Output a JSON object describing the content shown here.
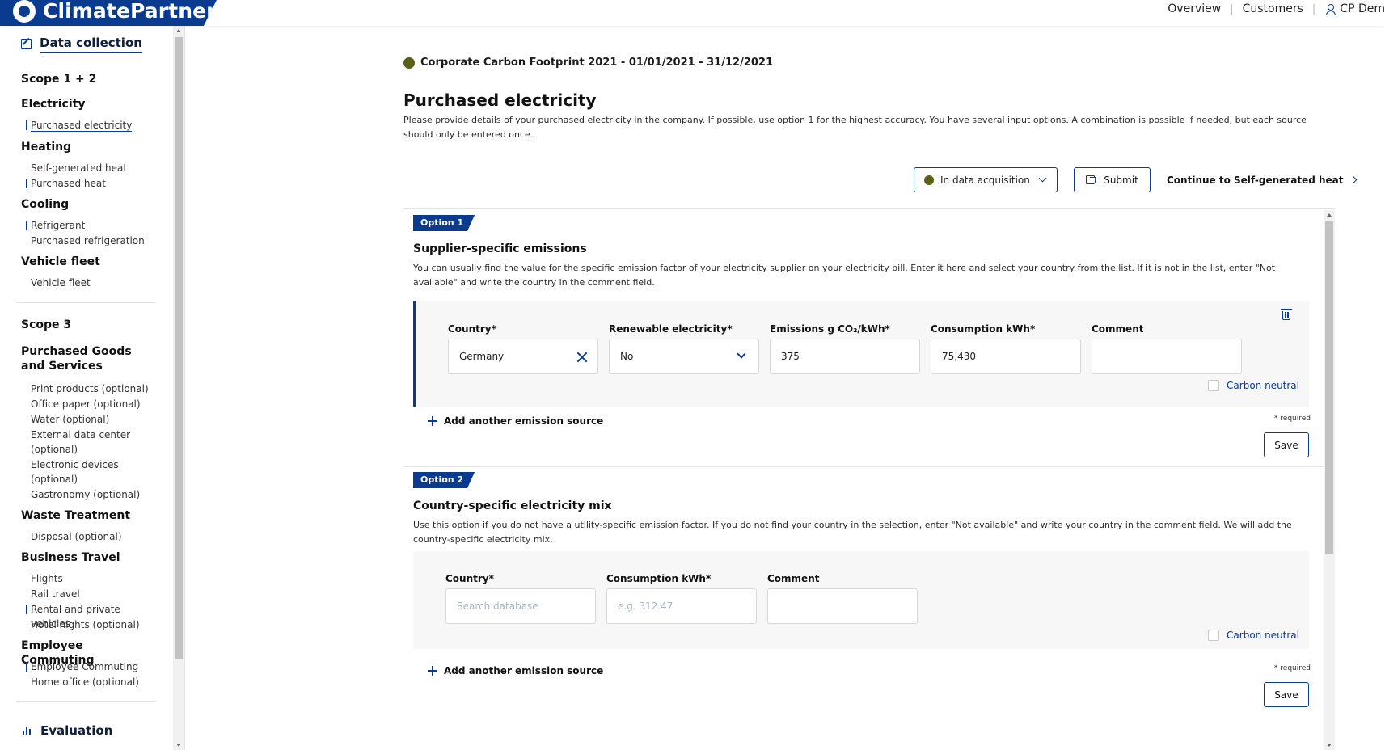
{
  "app": {
    "brand": "ClimatePartner"
  },
  "topnav": {
    "overview": "Overview",
    "customers": "Customers",
    "user": "CP Dem",
    "sep": "|"
  },
  "sidebar": {
    "data_collection": "Data collection",
    "scope12": "Scope 1 + 2",
    "electricity": {
      "title": "Electricity",
      "items": [
        "Purchased electricity"
      ]
    },
    "heating": {
      "title": "Heating",
      "items": [
        "Self-generated heat",
        "Purchased heat"
      ]
    },
    "cooling": {
      "title": "Cooling",
      "items": [
        "Refrigerant",
        "Purchased refrigeration"
      ]
    },
    "vehicle": {
      "title": "Vehicle fleet",
      "items": [
        "Vehicle fleet"
      ]
    },
    "scope3": "Scope 3",
    "goods": {
      "title": "Purchased Goods and Services",
      "items": [
        "Print products (optional)",
        "Office paper (optional)",
        "Water (optional)",
        "External data center (optional)",
        "Electronic devices (optional)",
        "Gastronomy (optional)"
      ]
    },
    "waste": {
      "title": "Waste Treatment",
      "items": [
        "Disposal (optional)"
      ]
    },
    "travel": {
      "title": "Business Travel",
      "items": [
        "Flights",
        "Rail travel",
        "Rental and private vehicles",
        "Hotel nights (optional)"
      ]
    },
    "commuting": {
      "title": "Employee Commuting",
      "items": [
        "Employee Commuting",
        "Home office (optional)"
      ]
    },
    "evaluation": "Evaluation"
  },
  "main": {
    "footprint": "Corporate Carbon Footprint 2021 - 01/01/2021 - 31/12/2021",
    "title": "Purchased electricity",
    "description": "Please provide details of your purchased electricity in the company. If possible, use option 1 for the highest accuracy. You have several input options. A combination is possible if needed, but each source should only be entered once.",
    "status": "In data acquisition",
    "submit": "Submit",
    "continue": "Continue to Self-generated heat",
    "option1": {
      "badge": "Option 1",
      "title": "Supplier-specific emissions",
      "description": "You can usually find the value for the specific emission factor of your electricity supplier on your electricity bill. Enter it here and select your country from the list. If it is not in the list, enter \"Not available\" and write the country in the comment field.",
      "labels": {
        "country": "Country*",
        "renewable": "Renewable electricity*",
        "emissions": "Emissions g CO₂/kWh*",
        "consumption": "Consumption kWh*",
        "comment": "Comment"
      },
      "values": {
        "country": "Germany",
        "renewable": "No",
        "emissions": "375",
        "consumption": "75,430",
        "comment": ""
      },
      "carbon_neutral": "Carbon neutral",
      "add": "Add another emission source",
      "required": "* required",
      "save": "Save"
    },
    "option2": {
      "badge": "Option 2",
      "title": "Country-specific electricity mix",
      "description": "Use this option if you do not have a utility-specific emission factor. If you do not find your country in the selection, enter \"Not available\" and write your country in the comment field. We will add the country-specific electricity mix.",
      "labels": {
        "country": "Country*",
        "consumption": "Consumption kWh*",
        "comment": "Comment"
      },
      "placeholders": {
        "country": "Search database",
        "consumption": "e.g. 312.47"
      },
      "carbon_neutral": "Carbon neutral",
      "add": "Add another emission source",
      "required": "* required",
      "save": "Save"
    }
  },
  "colors": {
    "brand_blue": "#0a3b8e",
    "status_olive": "#5a6116"
  }
}
